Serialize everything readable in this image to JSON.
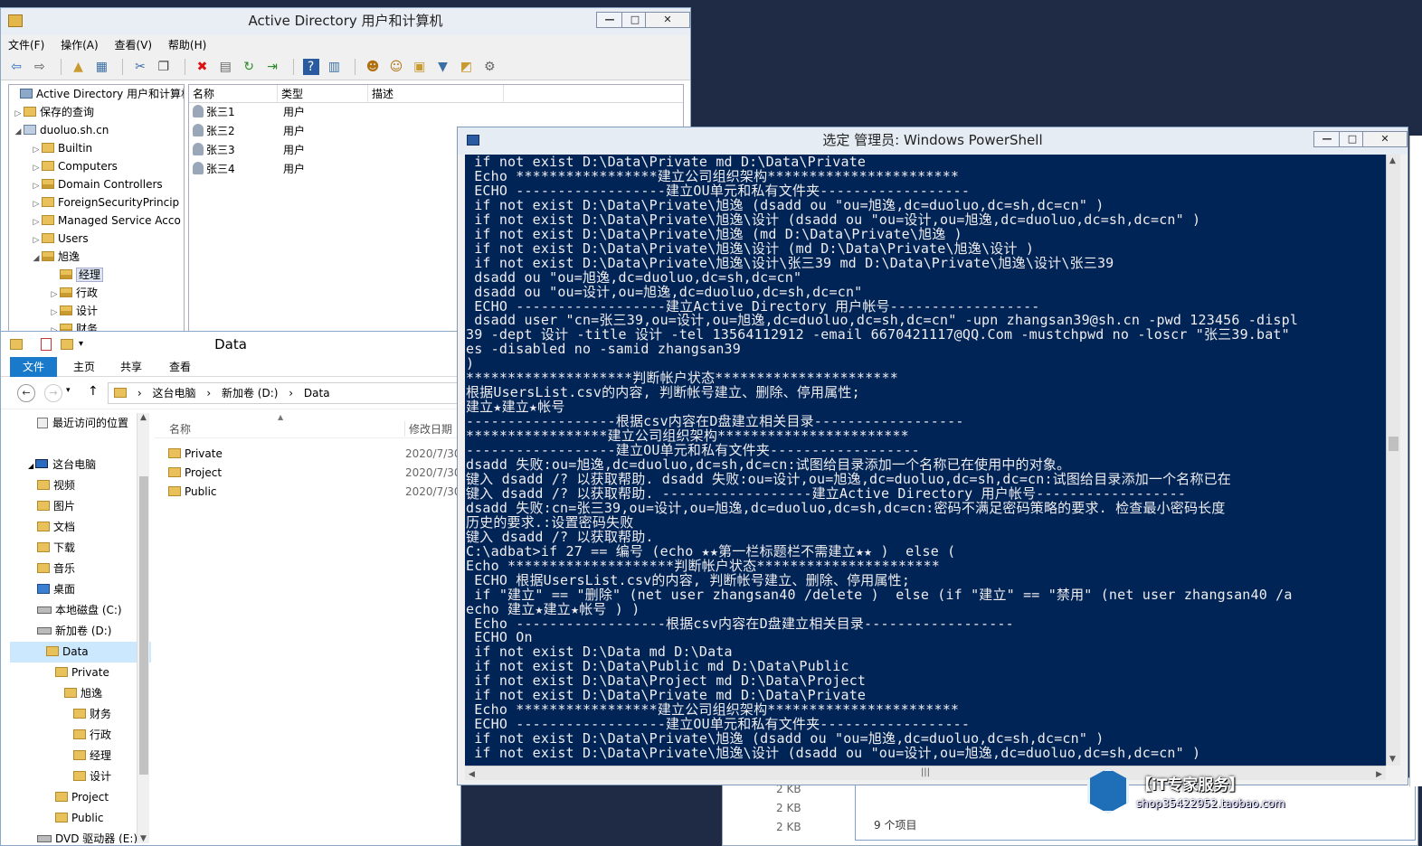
{
  "ad": {
    "title": "Active Directory 用户和计算机",
    "menu": [
      "文件(F)",
      "操作(A)",
      "查看(V)",
      "帮助(H)"
    ],
    "tree": [
      {
        "label": "Active Directory 用户和计算机",
        "arrow": ""
      },
      {
        "label": "保存的查询",
        "arrow": "▷"
      },
      {
        "label": "duoluo.sh.cn",
        "arrow": "◢"
      },
      {
        "label": "Builtin",
        "arrow": "▷"
      },
      {
        "label": "Computers",
        "arrow": "▷"
      },
      {
        "label": "Domain Controllers",
        "arrow": "▷"
      },
      {
        "label": "ForeignSecurityPrincip",
        "arrow": "▷"
      },
      {
        "label": "Managed Service Acco",
        "arrow": "▷"
      },
      {
        "label": "Users",
        "arrow": "▷"
      },
      {
        "label": "旭逸",
        "arrow": "◢"
      },
      {
        "label": "经理",
        "arrow": ""
      },
      {
        "label": "行政",
        "arrow": "▷"
      },
      {
        "label": "设计",
        "arrow": "▷"
      },
      {
        "label": "财务",
        "arrow": "▷"
      }
    ],
    "columns": [
      "名称",
      "类型",
      "描述"
    ],
    "rows": [
      {
        "name": "张三1",
        "type": "用户"
      },
      {
        "name": "张三2",
        "type": "用户"
      },
      {
        "name": "张三3",
        "type": "用户"
      },
      {
        "name": "张三4",
        "type": "用户"
      }
    ]
  },
  "explorer": {
    "title": "Data",
    "tabs": [
      "文件",
      "主页",
      "共享",
      "查看"
    ],
    "breadcrumb": [
      "这台电脑",
      "新加卷 (D:)",
      "Data"
    ],
    "nav": [
      {
        "label": "最近访问的位置",
        "indent": 30
      },
      {
        "label": "",
        "indent": 0
      },
      {
        "label": "这台电脑",
        "indent": 20
      },
      {
        "label": "视频",
        "indent": 30
      },
      {
        "label": "图片",
        "indent": 30
      },
      {
        "label": "文档",
        "indent": 30
      },
      {
        "label": "下载",
        "indent": 30
      },
      {
        "label": "音乐",
        "indent": 30
      },
      {
        "label": "桌面",
        "indent": 30
      },
      {
        "label": "本地磁盘 (C:)",
        "indent": 30
      },
      {
        "label": "新加卷 (D:)",
        "indent": 30
      },
      {
        "label": "Data",
        "indent": 40
      },
      {
        "label": "Private",
        "indent": 50
      },
      {
        "label": "旭逸",
        "indent": 60
      },
      {
        "label": "财务",
        "indent": 70
      },
      {
        "label": "行政",
        "indent": 70
      },
      {
        "label": "经理",
        "indent": 70
      },
      {
        "label": "设计",
        "indent": 70
      },
      {
        "label": "Project",
        "indent": 50
      },
      {
        "label": "Public",
        "indent": 50
      },
      {
        "label": "DVD 驱动器 (E:)",
        "indent": 30
      }
    ],
    "columns": [
      "名称",
      "修改日期"
    ],
    "files": [
      {
        "name": "Private",
        "date": "2020/7/30"
      },
      {
        "name": "Project",
        "date": "2020/7/30"
      },
      {
        "name": "Public",
        "date": "2020/7/30"
      }
    ]
  },
  "powershell": {
    "title": "选定 管理员: Windows PowerShell",
    "lines": [
      " if not exist D:\\Data\\Private md D:\\Data\\Private",
      " Echo *****************建立公司组织架构***********************",
      " ECHO ------------------建立OU单元和私有文件夹------------------",
      " if not exist D:\\Data\\Private\\旭逸 (dsadd ou \"ou=旭逸,dc=duoluo,dc=sh,dc=cn\" )",
      " if not exist D:\\Data\\Private\\旭逸\\设计 (dsadd ou \"ou=设计,ou=旭逸,dc=duoluo,dc=sh,dc=cn\" )",
      " if not exist D:\\Data\\Private\\旭逸 (md D:\\Data\\Private\\旭逸 )",
      " if not exist D:\\Data\\Private\\旭逸\\设计 (md D:\\Data\\Private\\旭逸\\设计 )",
      " if not exist D:\\Data\\Private\\旭逸\\设计\\张三39 md D:\\Data\\Private\\旭逸\\设计\\张三39",
      " dsadd ou \"ou=旭逸,dc=duoluo,dc=sh,dc=cn\"",
      " dsadd ou \"ou=设计,ou=旭逸,dc=duoluo,dc=sh,dc=cn\"",
      " ECHO ------------------建立Active Directory 用户帐号------------------",
      " dsadd user \"cn=张三39,ou=设计,ou=旭逸,dc=duoluo,dc=sh,dc=cn\" -upn zhangsan39@sh.cn -pwd 123456 -displ",
      "39 -dept 设计 -title 设计 -tel 13564112912 -email 6670421117@QQ.Com -mustchpwd no -loscr \"张三39.bat\"",
      "es -disabled no -samid zhangsan39",
      ")",
      "********************判断帐户状态**********************",
      "根据UsersList.csv的内容, 判断帐号建立、删除、停用属性;",
      "建立★建立★帐号",
      "------------------根据csv内容在D盘建立相关目录------------------",
      "*****************建立公司组织架构***********************",
      "------------------建立OU单元和私有文件夹------------------",
      "dsadd 失败:ou=旭逸,dc=duoluo,dc=sh,dc=cn:试图给目录添加一个名称已在使用中的对象。",
      "键入 dsadd /? 以获取帮助. dsadd 失败:ou=设计,ou=旭逸,dc=duoluo,dc=sh,dc=cn:试图给目录添加一个名称已在",
      "键入 dsadd /? 以获取帮助. ------------------建立Active Directory 用户帐号------------------",
      "dsadd 失败:cn=张三39,ou=设计,ou=旭逸,dc=duoluo,dc=sh,dc=cn:密码不满足密码策略的要求. 检查最小密码长度",
      "历史的要求.:设置密码失败",
      "键入 dsadd /? 以获取帮助.",
      "C:\\adbat>if 27 == 编号 (echo ★★第一栏标题栏不需建立★★ )  else (",
      "Echo ********************判断帐户状态**********************",
      " ECHO 根据UsersList.csv的内容, 判断帐号建立、删除、停用属性;",
      " if \"建立\" == \"删除\" (net user zhangsan40 /delete )  else (if \"建立\" == \"禁用\" (net user zhangsan40 /a",
      "echo 建立★建立★帐号 ) )",
      " Echo ------------------根据csv内容在D盘建立相关目录------------------",
      " ECHO On",
      " if not exist D:\\Data md D:\\Data",
      " if not exist D:\\Data\\Public md D:\\Data\\Public",
      " if not exist D:\\Data\\Project md D:\\Data\\Project",
      " if not exist D:\\Data\\Private md D:\\Data\\Private",
      " Echo *****************建立公司组织架构***********************",
      " ECHO ------------------建立OU单元和私有文件夹------------------",
      " if not exist D:\\Data\\Private\\旭逸 (dsadd ou \"ou=旭逸,dc=duoluo,dc=sh,dc=cn\" )",
      " if not exist D:\\Data\\Private\\旭逸\\设计 (dsadd ou \"ou=设计,ou=旭逸,dc=duoluo,dc=sh,dc=cn\" )"
    ]
  },
  "background": {
    "sizes": [
      "2 KB",
      "2 KB",
      "2 KB"
    ],
    "item_count": "9 个项目"
  },
  "watermark": {
    "title": "【iT专家服务】",
    "url": "shop35422952.taobao.com"
  },
  "colors": {
    "console_bg": "#012456",
    "console_fg": "#eeedf0",
    "ribbon_file": "#1979ca"
  }
}
